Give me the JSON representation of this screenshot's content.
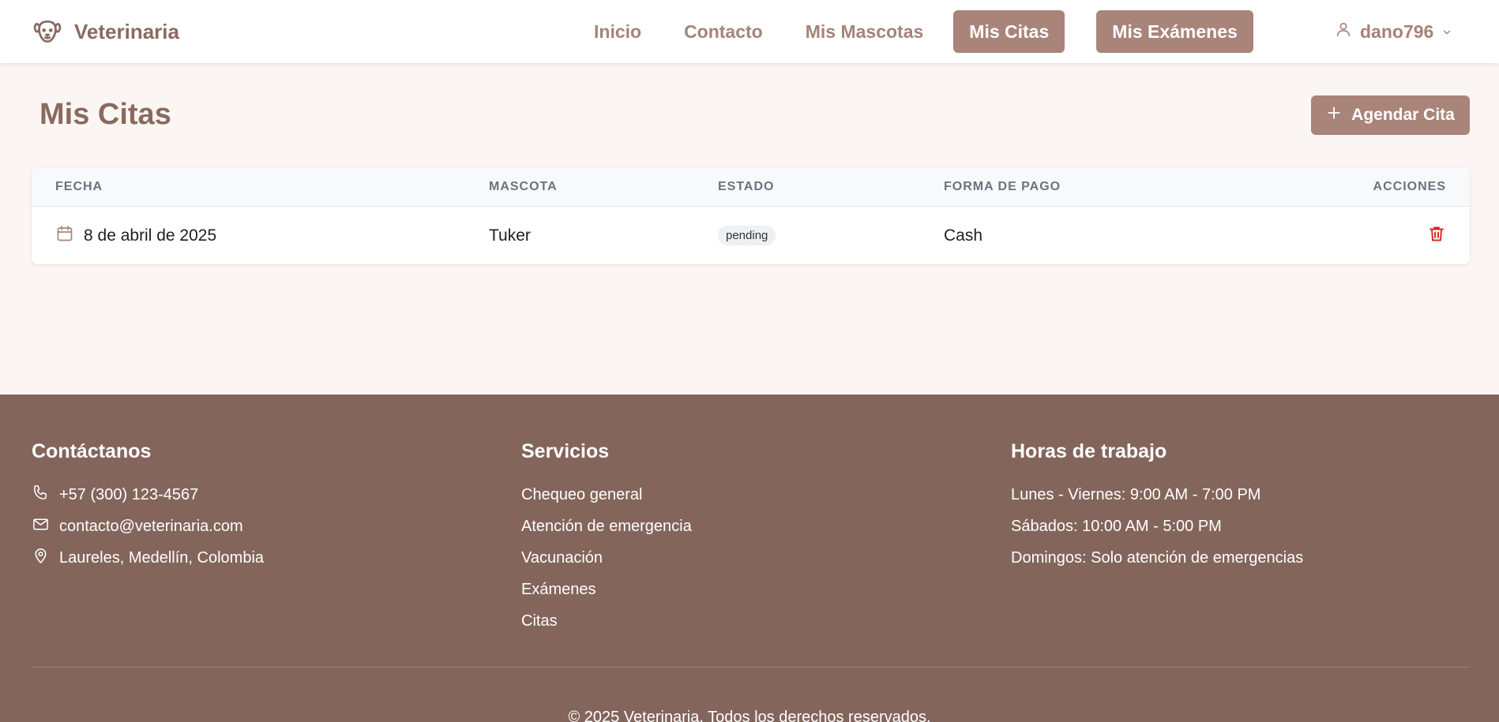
{
  "brand": {
    "name": "Veterinaria",
    "icon": "dog-face-icon"
  },
  "nav": {
    "links": [
      {
        "label": "Inicio",
        "active": false
      },
      {
        "label": "Contacto",
        "active": false
      },
      {
        "label": "Mis Mascotas",
        "active": false
      },
      {
        "label": "Mis Citas",
        "active": true
      },
      {
        "label": "Mis Exámenes",
        "active": true
      }
    ],
    "user": {
      "name": "dano796",
      "icon": "user-icon"
    }
  },
  "main": {
    "title": "Mis Citas",
    "add_button": "Agendar Cita",
    "table": {
      "headers": [
        "Fecha",
        "Mascota",
        "Estado",
        "Forma de pago",
        "Acciones"
      ],
      "rows": [
        {
          "fecha": "8 de abril de 2025",
          "mascota": "Tuker",
          "estado": "pending",
          "pago": "Cash"
        }
      ]
    }
  },
  "footer": {
    "contact": {
      "title": "Contáctanos",
      "phone": "+57 (300) 123-4567",
      "email": "contacto@veterinaria.com",
      "address": "Laureles, Medellín, Colombia"
    },
    "services": {
      "title": "Servicios",
      "items": [
        "Chequeo general",
        "Atención de emergencia",
        "Vacunación",
        "Exámenes",
        "Citas"
      ]
    },
    "hours": {
      "title": "Horas de trabajo",
      "items": [
        "Lunes - Viernes: 9:00 AM - 7:00 PM",
        "Sábados: 10:00 AM - 5:00 PM",
        "Domingos: Solo atención de emergencias"
      ]
    },
    "copyright": "© 2025 Veterinaria. Todos los derechos reservados."
  },
  "colors": {
    "accent": "#a98479",
    "brand_text": "#8a6a5f",
    "footer_bg": "#84655b",
    "page_bg": "#fbf6f3",
    "danger": "#dc2626"
  }
}
